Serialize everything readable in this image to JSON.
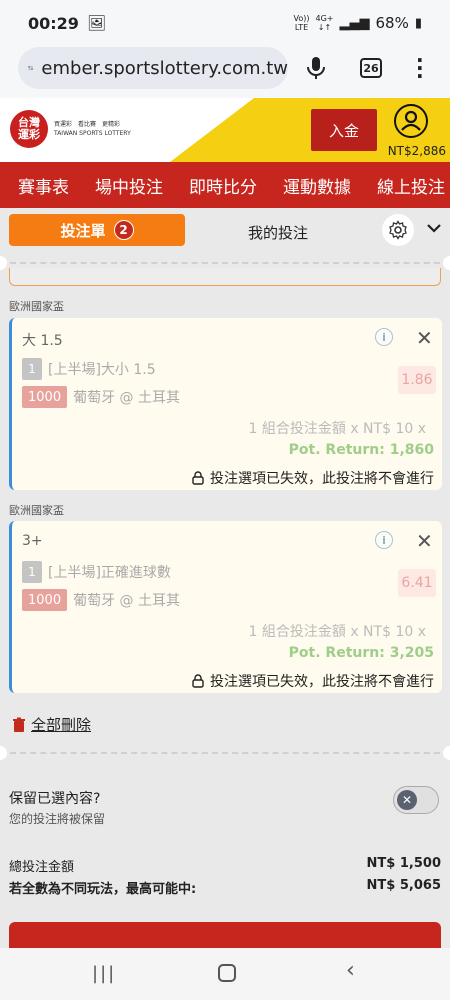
{
  "status": {
    "time": "00:29",
    "battery": "68%",
    "vol_lte": "VoLTE",
    "net": "4G+"
  },
  "browser": {
    "url": "ember.sportslottery.com.tw",
    "tab_count": "26"
  },
  "header": {
    "logo_text": "台灣\n運彩",
    "logo_sub1": "買運彩　看比賽　更精彩",
    "logo_sub2": "TAIWAN SPORTS LOTTERY",
    "deposit_label": "入金",
    "balance": "NT$2,886"
  },
  "nav": {
    "items": [
      "賽事表",
      "場中投注",
      "即時比分",
      "運動數據",
      "線上投注"
    ]
  },
  "betslip": {
    "tab_active_label": "投注單",
    "tab_active_count": "2",
    "tab_mine_label": "我的投注",
    "bets": [
      {
        "section": "歐洲國家盃",
        "selection": "大 1.5",
        "line_number": "1",
        "market": "[上半場]大小 1.5",
        "stake": "1000",
        "match": "葡萄牙 @ 土耳其",
        "odds": "1.86",
        "combo_text": "1 組合投注金額 x NT$ 10 x",
        "pot_return": "Pot. Return: 1,860",
        "invalid_text": "投注選項已失效，此投注將不會進行"
      },
      {
        "section": "歐洲國家盃",
        "selection": "3+",
        "line_number": "1",
        "market": "[上半場]正確進球數",
        "stake": "1000",
        "match": "葡萄牙 @ 土耳其",
        "odds": "6.41",
        "combo_text": "1 組合投注金額 x NT$ 10 x",
        "pot_return": "Pot. Return: 3,205",
        "invalid_text": "投注選項已失效，此投注將不會進行"
      }
    ],
    "delete_all_label": "全部刪除",
    "keep_title": "保留已選內容?",
    "keep_subtitle": "您的投注將被保留",
    "total_label": "總投注金額",
    "total_value": "NT$ 1,500",
    "max_win_label": "若全數為不同玩法，最高可能中:",
    "max_win_value": "NT$ 5,065"
  },
  "colors": {
    "brand_red": "#c7261f",
    "tab_orange": "#f57c12",
    "accent_blue": "#3a8fdc",
    "header_yellow": "#f4cf12"
  }
}
